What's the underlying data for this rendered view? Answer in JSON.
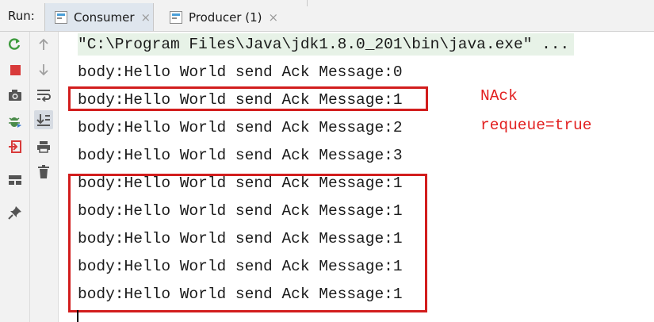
{
  "run_panel": {
    "label": "Run:",
    "tabs": [
      {
        "label": "Consumer",
        "active": true,
        "close": "×"
      },
      {
        "label": "Producer (1)",
        "active": false,
        "close": "×"
      }
    ]
  },
  "toolbar": {
    "left_icons": [
      "rerun-icon",
      "stop-icon",
      "camera-icon",
      "debug-icon",
      "exit-icon",
      "layout-icon",
      "pin-icon"
    ],
    "right_icons": [
      "arrow-up-icon",
      "arrow-down-icon",
      "soft-wrap-icon",
      "scroll-to-end-icon",
      "print-icon",
      "trash-icon"
    ]
  },
  "console": {
    "command_line": "\"C:\\Program Files\\Java\\jdk1.8.0_201\\bin\\java.exe\" ...",
    "lines": [
      "body:Hello World send Ack Message:0",
      "body:Hello World send Ack Message:1",
      "body:Hello World send Ack Message:2",
      "body:Hello World send Ack Message:3",
      "body:Hello World send Ack Message:1",
      "body:Hello World send Ack Message:1",
      "body:Hello World send Ack Message:1",
      "body:Hello World send Ack Message:1",
      "body:Hello World send Ack Message:1"
    ]
  },
  "annotations": {
    "nack": "NAck",
    "requeue": "requeue=true"
  },
  "colors": {
    "highlight": "#d21d1d",
    "annotation_text": "#e21f1f",
    "command_bg": "#e7f2e7",
    "active_tab_bg": "#dfe6ee"
  }
}
